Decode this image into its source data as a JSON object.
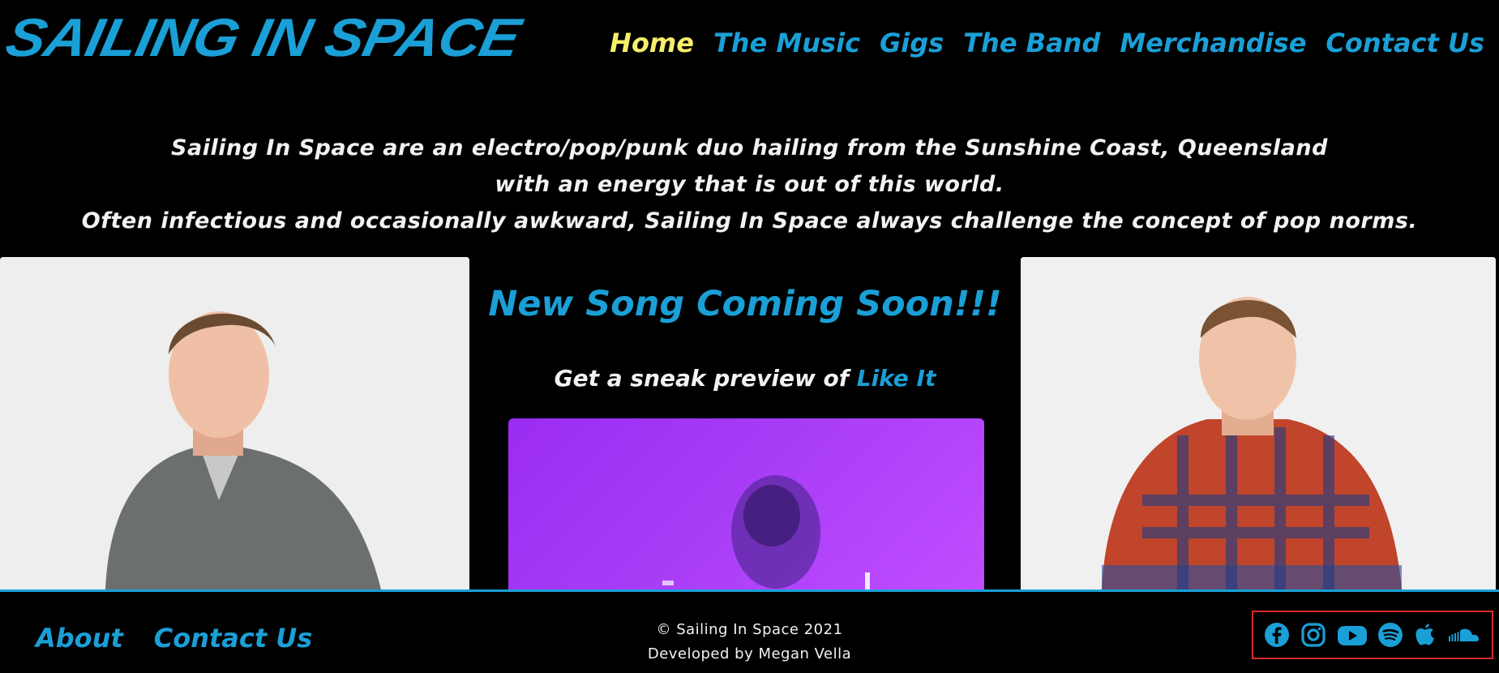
{
  "header": {
    "logo_text": "SAILING IN SPACE",
    "nav": [
      {
        "label": "Home",
        "active": true
      },
      {
        "label": "The Music"
      },
      {
        "label": "Gigs"
      },
      {
        "label": "The Band"
      },
      {
        "label": "Merchandise"
      },
      {
        "label": "Contact Us"
      }
    ]
  },
  "intro": {
    "lines": [
      "Sailing In Space are an electro/pop/punk duo hailing from the Sunshine Coast, Queensland",
      "with an energy that is out of this world.",
      "Often infectious and occasionally awkward, Sailing In Space always challenge the concept of pop norms."
    ]
  },
  "main": {
    "song_title": "New Song Coming Soon!!!",
    "preview_text": "Get a sneak preview of ",
    "preview_link": "Like It"
  },
  "footer": {
    "links": [
      "About",
      "Contact Us"
    ],
    "copyright": "© Sailing In Space 2021",
    "developer": "Developed by Megan Vella",
    "social_icons": [
      "facebook-icon",
      "instagram-icon",
      "youtube-icon",
      "spotify-icon",
      "apple-icon",
      "soundcloud-icon"
    ]
  },
  "colors": {
    "accent": "#1a9fd6",
    "active_nav": "#f7ee6a",
    "background": "#000000",
    "social_highlight_border": "#d92b2b"
  }
}
